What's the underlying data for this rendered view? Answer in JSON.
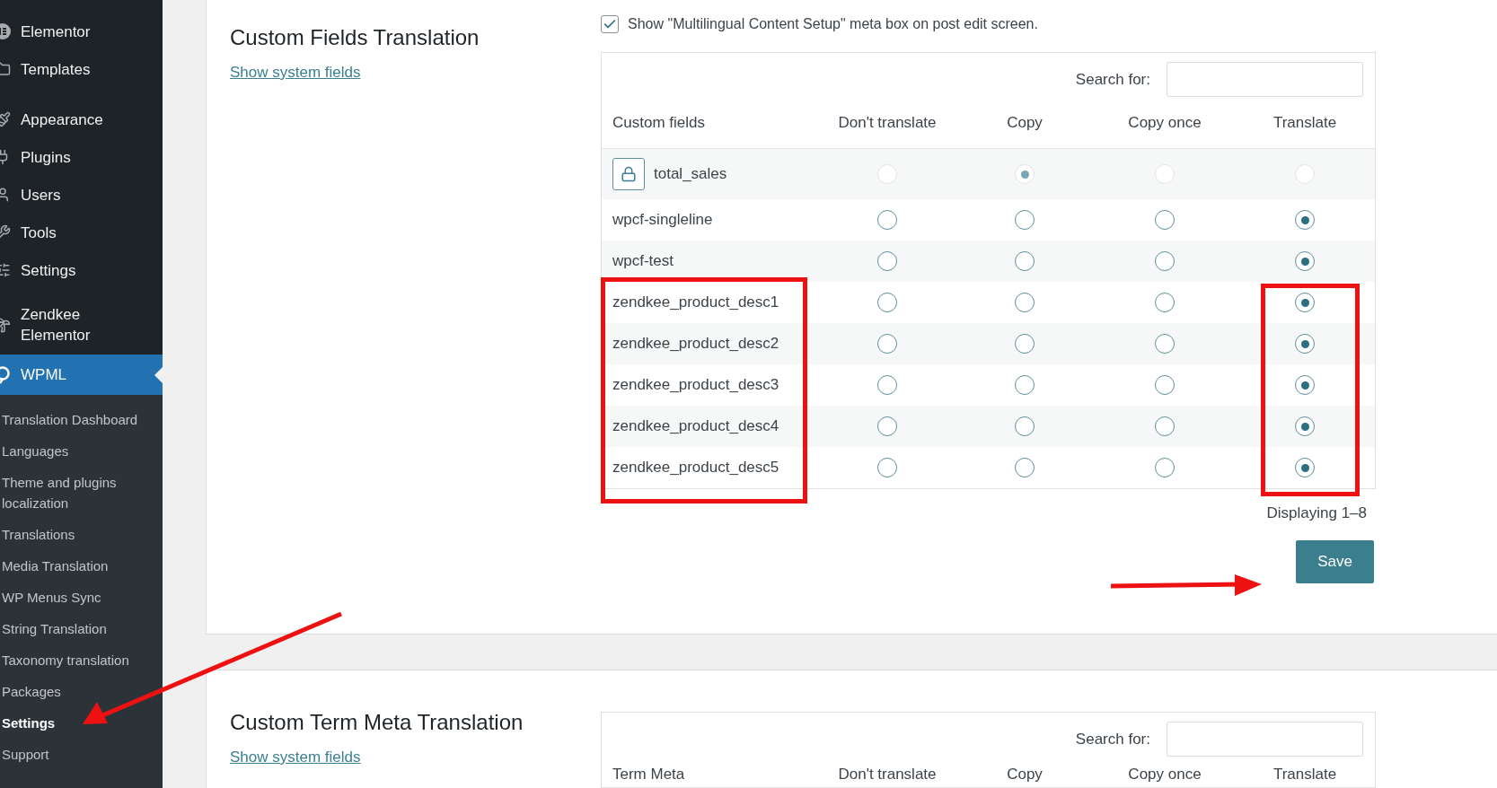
{
  "sidebar": {
    "groups": [
      {
        "items": [
          {
            "label": "Elementor",
            "kind": "elementor",
            "selected": false
          },
          {
            "label": "Templates",
            "kind": "folder",
            "selected": false
          }
        ]
      },
      {
        "items": [
          {
            "label": "Appearance",
            "kind": "brush",
            "selected": false
          },
          {
            "label": "Plugins",
            "kind": "plug",
            "selected": false
          },
          {
            "label": "Users",
            "kind": "user",
            "selected": false
          },
          {
            "label": "Tools",
            "kind": "wrench",
            "selected": false
          },
          {
            "label": "Settings",
            "kind": "sliders",
            "selected": false
          }
        ]
      },
      {
        "items": [
          {
            "label": "Zendkee Elementor",
            "kind": "palm",
            "selected": false
          },
          {
            "label": "WPML",
            "kind": "wpml",
            "selected": true
          }
        ]
      }
    ],
    "submenu": [
      {
        "label": "Translation Dashboard",
        "selected": false
      },
      {
        "label": "Languages",
        "selected": false
      },
      {
        "label": "Theme and plugins localization",
        "selected": false
      },
      {
        "label": "Translations",
        "selected": false
      },
      {
        "label": "Media Translation",
        "selected": false
      },
      {
        "label": "WP Menus Sync",
        "selected": false
      },
      {
        "label": "String Translation",
        "selected": false
      },
      {
        "label": "Taxonomy translation",
        "selected": false
      },
      {
        "label": "Packages",
        "selected": false
      },
      {
        "label": "Settings",
        "selected": true
      },
      {
        "label": "Support",
        "selected": false
      }
    ]
  },
  "custom_fields": {
    "title": "Custom Fields Translation",
    "link": "Show system fields",
    "meta_box": {
      "label": "Show \"Multilingual Content Setup\" meta box on post edit screen.",
      "checked": true
    },
    "search_label": "Search for:",
    "columns": [
      "Custom fields",
      "Don't translate",
      "Copy",
      "Copy once",
      "Translate"
    ],
    "rows": [
      {
        "name": "total_sales",
        "locked": true,
        "options": [
          {
            "selected": false
          },
          {
            "selected": true
          },
          {
            "selected": false
          },
          {
            "selected": false
          }
        ]
      },
      {
        "name": "wpcf-singleline",
        "locked": false,
        "options": [
          {
            "selected": false
          },
          {
            "selected": false
          },
          {
            "selected": false
          },
          {
            "selected": true
          }
        ]
      },
      {
        "name": "wpcf-test",
        "locked": false,
        "options": [
          {
            "selected": false
          },
          {
            "selected": false
          },
          {
            "selected": false
          },
          {
            "selected": true
          }
        ]
      },
      {
        "name": "zendkee_product_desc1",
        "locked": false,
        "options": [
          {
            "selected": false
          },
          {
            "selected": false
          },
          {
            "selected": false
          },
          {
            "selected": true
          }
        ]
      },
      {
        "name": "zendkee_product_desc2",
        "locked": false,
        "options": [
          {
            "selected": false
          },
          {
            "selected": false
          },
          {
            "selected": false
          },
          {
            "selected": true
          }
        ]
      },
      {
        "name": "zendkee_product_desc3",
        "locked": false,
        "options": [
          {
            "selected": false
          },
          {
            "selected": false
          },
          {
            "selected": false
          },
          {
            "selected": true
          }
        ]
      },
      {
        "name": "zendkee_product_desc4",
        "locked": false,
        "options": [
          {
            "selected": false
          },
          {
            "selected": false
          },
          {
            "selected": false
          },
          {
            "selected": true
          }
        ]
      },
      {
        "name": "zendkee_product_desc5",
        "locked": false,
        "options": [
          {
            "selected": false
          },
          {
            "selected": false
          },
          {
            "selected": false
          },
          {
            "selected": true
          }
        ]
      }
    ],
    "pagination": "Displaying 1–8",
    "save_button": "Save"
  },
  "term_meta": {
    "title": "Custom Term Meta Translation",
    "link": "Show system fields",
    "search_label": "Search for:",
    "columns": [
      "Term Meta",
      "Don't translate",
      "Copy",
      "Copy once",
      "Translate"
    ]
  }
}
